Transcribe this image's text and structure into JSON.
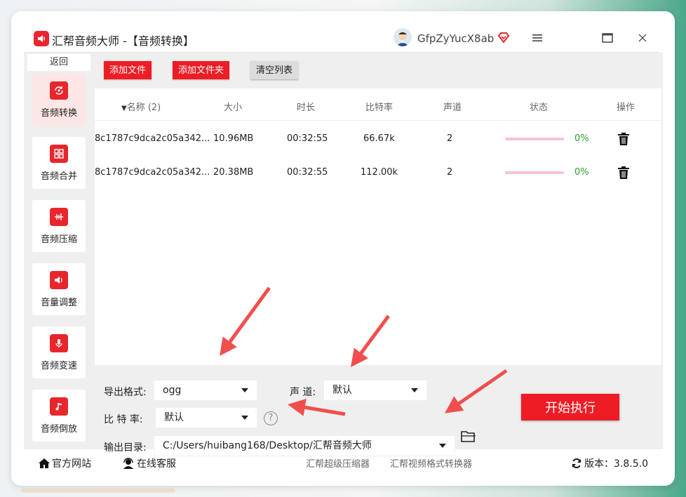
{
  "window": {
    "app_title": "汇帮音频大师  -【音频转换】",
    "user_name": "GfpZyYucX8ab",
    "icons": [
      "speaker-logo-icon",
      "avatar",
      "vip-diamond-icon",
      "menu-icon",
      "maximize-icon",
      "close-icon"
    ]
  },
  "sidebar": {
    "back_label": "返回",
    "items": [
      {
        "label": "音频转换",
        "icon": "convert-icon",
        "active": true
      },
      {
        "label": "音频合并",
        "icon": "merge-icon",
        "active": false
      },
      {
        "label": "音频压缩",
        "icon": "compress-icon",
        "active": false
      },
      {
        "label": "音量调整",
        "icon": "volume-icon",
        "active": false
      },
      {
        "label": "音频变速",
        "icon": "microphone-icon",
        "active": false
      },
      {
        "label": "音频倒放",
        "icon": "music-note-icon",
        "active": false
      }
    ]
  },
  "toolbar": {
    "add_file": "添加文件",
    "add_folder": "添加文件夹",
    "clear_list": "清空列表"
  },
  "table": {
    "columns": [
      "名称 (2)",
      "大小",
      "时长",
      "比特率",
      "声道",
      "状态",
      "操作"
    ],
    "rows": [
      {
        "name": "8c1787c9dca2c05a342...",
        "size": "10.96MB",
        "duration": "00:32:55",
        "bitrate": "66.67k",
        "channels": "2",
        "progress": "0%"
      },
      {
        "name": "8c1787c9dca2c05a342...",
        "size": "20.38MB",
        "duration": "00:32:55",
        "bitrate": "112.00k",
        "channels": "2",
        "progress": "0%"
      }
    ]
  },
  "settings": {
    "format_label": "导出格式:",
    "format_value": "ogg",
    "channel_label": "声 道:",
    "channel_value": "默认",
    "bitrate_label": "比 特 率:",
    "bitrate_value": "默认",
    "help_glyph": "?",
    "output_label": "输出目录:",
    "output_value": "C:/Users/huibang168/Desktop/汇帮音频大师",
    "start_button": "开始执行"
  },
  "footer": {
    "website": "官方网站",
    "support": "在线客服",
    "link1": "汇帮超级压缩器",
    "link2": "汇帮视频格式转换器",
    "version": "版本：3.8.5.0"
  },
  "colors": {
    "brand_red": "#ee1c25",
    "progress_pink": "#f7c3d2",
    "percent_green": "#2aa12a",
    "annotation_arrow": "#f04e4e"
  }
}
